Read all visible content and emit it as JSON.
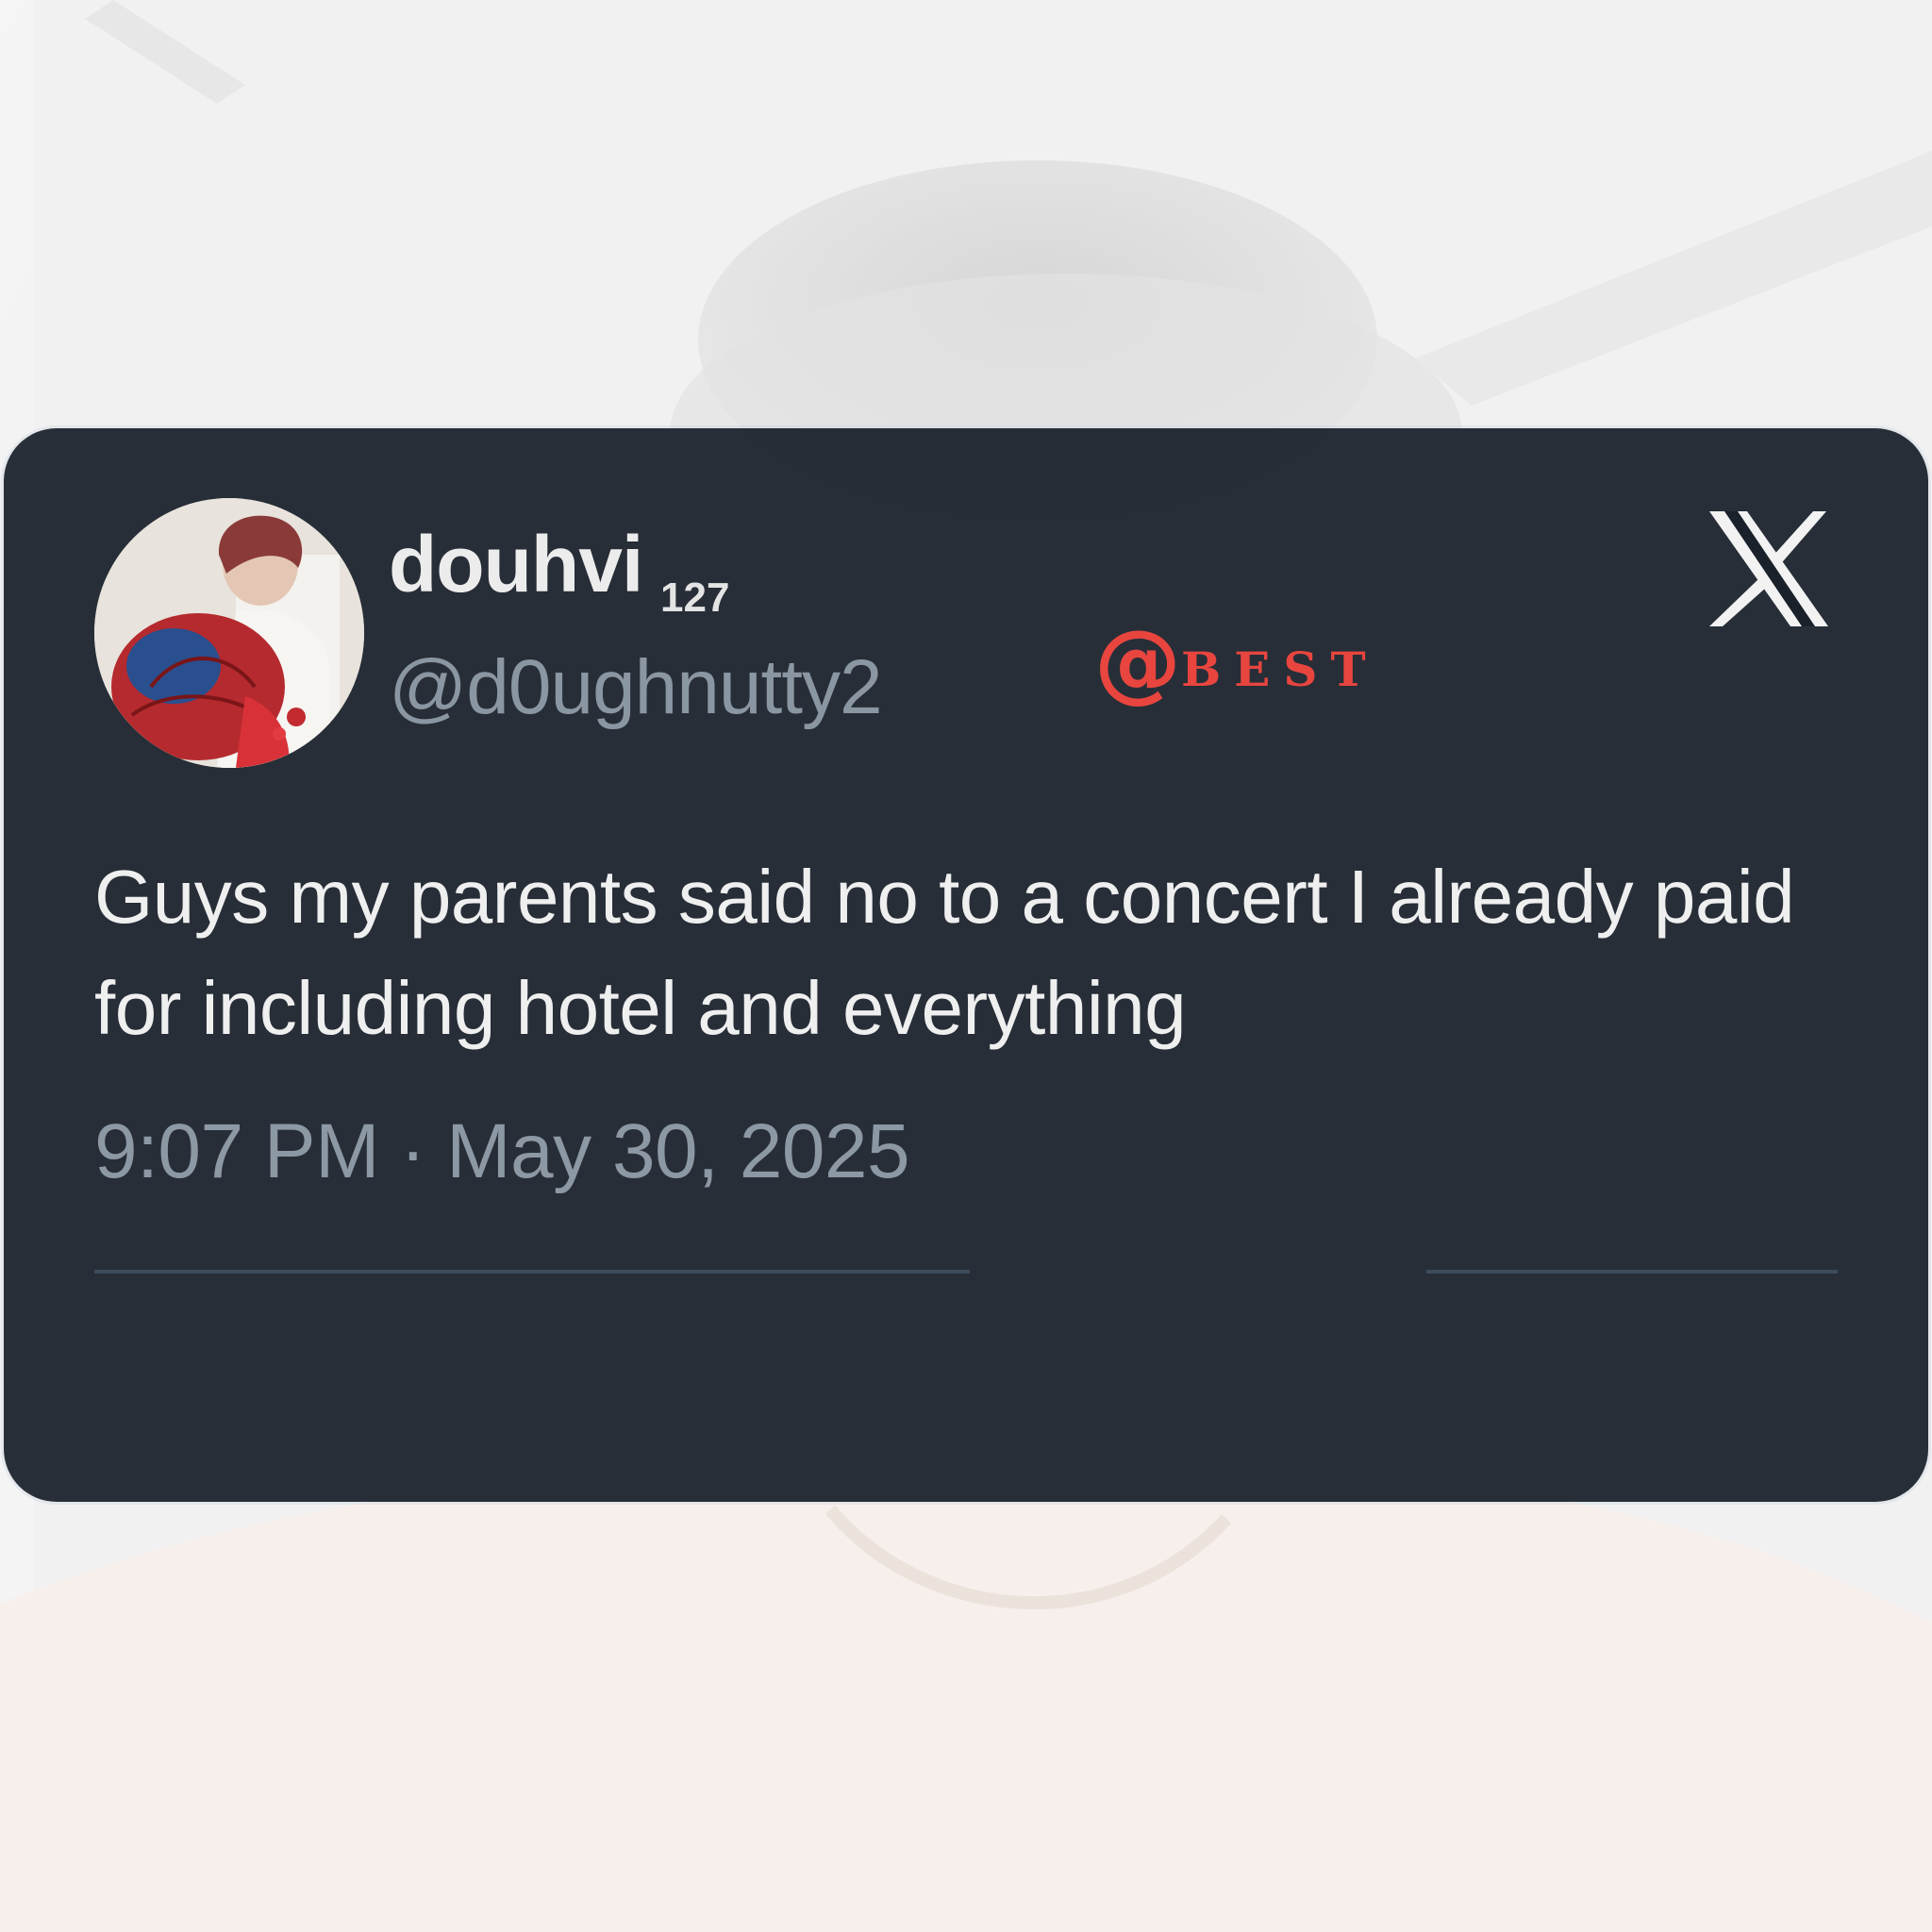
{
  "tweet": {
    "display_name": "douhvi",
    "name_count": "127",
    "handle": "@d0ughnutty2",
    "text": "Guys my parents said no to a concert I already paid for including hotel and everything",
    "timestamp": "9:07 PM · May 30, 2025",
    "avatar_icon": "profile-photo-avatar",
    "platform_icon": "x-logo-icon"
  },
  "watermark": {
    "at": "@",
    "word": "BEST",
    "color": "#e8453f"
  },
  "colors": {
    "card_bg": "#181f29",
    "handle": "#8b96a3",
    "text": "#efefef",
    "divider": "#3d4b5b"
  }
}
